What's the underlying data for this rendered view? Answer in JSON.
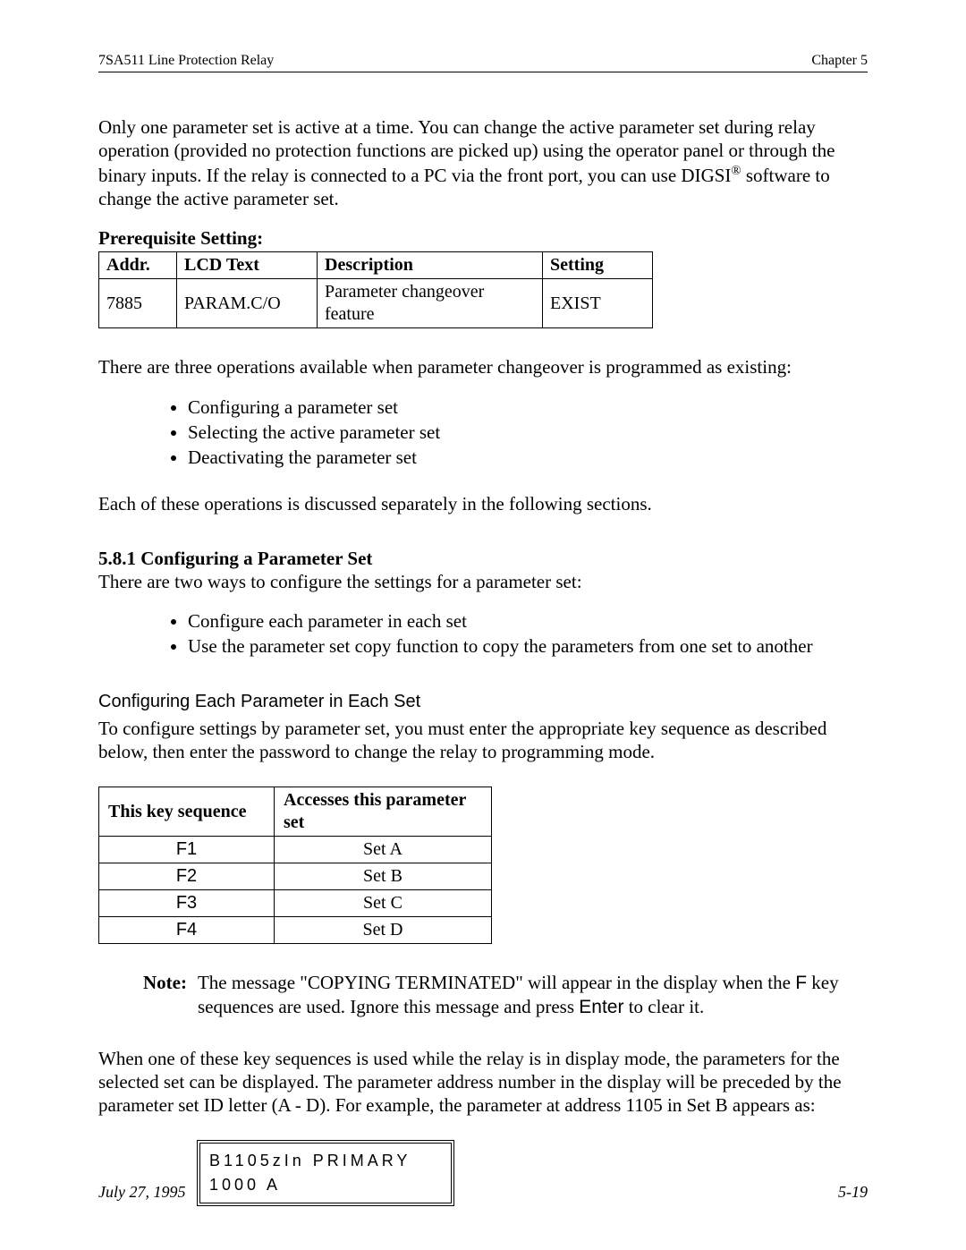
{
  "header": {
    "left": "7SA511 Line Protection Relay",
    "right": "Chapter 5"
  },
  "intro": "Only one parameter set is active at a time. You can change the active parameter set during relay operation (provided no protection functions are picked up) using the operator panel or through the binary inputs. If the relay is connected to a PC via the front port, you can use DIGSI",
  "intro_sup": "®",
  "intro_tail": " software to change the active parameter set.",
  "prereq_label": "Prerequisite Setting:",
  "prereq_table": {
    "headers": [
      "Addr.",
      "LCD Text",
      "Description",
      "Setting"
    ],
    "row": [
      "7885",
      "PARAM.C/O",
      "Parameter changeover feature",
      "EXIST"
    ]
  },
  "ops_intro": "There are three operations available when parameter changeover is programmed as existing:",
  "ops": [
    "Configuring a parameter set",
    "Selecting the active parameter set",
    "Deactivating the parameter set"
  ],
  "ops_outro": "Each of these operations is discussed separately in the following sections.",
  "sec_581_heading": "5.8.1  Configuring a Parameter Set",
  "sec_581_intro": "There are two ways to configure the settings for a parameter set:",
  "sec_581_bullets": [
    "Configure each parameter in each set",
    "Use the parameter set copy function to copy the parameters from one set to another"
  ],
  "subsec_heading": "Configuring Each Parameter in Each Set",
  "subsec_intro": "To configure settings by parameter set, you must enter the appropriate key sequence as described below, then enter the password to change the relay to programming mode.",
  "keyseq_table": {
    "headers": [
      "This key sequence",
      "Accesses this parameter set"
    ],
    "rows": [
      [
        "F1",
        "Set A"
      ],
      [
        "F2",
        "Set B"
      ],
      [
        "F3",
        "Set C"
      ],
      [
        "F4",
        "Set D"
      ]
    ]
  },
  "note_label": "Note:",
  "note_body_1": "The message \"COPYING TERMINATED\" will appear in the display when the ",
  "note_key_f": "F",
  "note_body_2": " key sequences are used. Ignore this message and press ",
  "note_key_enter": "Enter",
  "note_body_3": " to clear it.",
  "display_mode_para": "When one of these key sequences is used while the relay is in display mode, the parameters for the selected set can be displayed. The parameter address number in the display will be preceded by the parameter set ID letter (A - D). For example, the parameter at address 1105 in Set B appears as:",
  "lcd": {
    "line1": "B1105zIn PRIMARY",
    "line2": "1000 A"
  },
  "footer": {
    "left": "July 27, 1995",
    "right": "5-19"
  }
}
